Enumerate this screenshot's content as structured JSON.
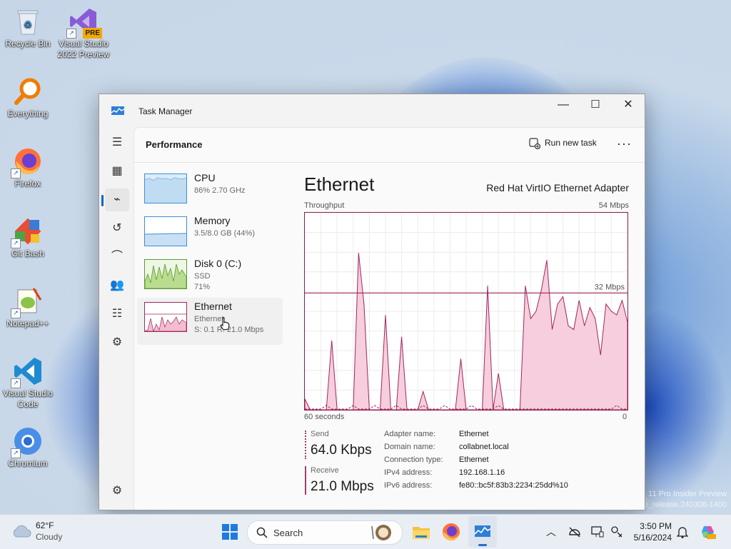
{
  "desktop": {
    "icons": [
      {
        "label": "Recycle Bin",
        "icon": "recycle-bin-icon"
      },
      {
        "label": "Visual Studio 2022 Preview",
        "icon": "visual-studio-icon",
        "badge": "PRE"
      },
      {
        "label": "Everything",
        "icon": "everything-search-icon"
      },
      {
        "label": "Firefox",
        "icon": "firefox-icon"
      },
      {
        "label": "Git Bash",
        "icon": "git-bash-icon"
      },
      {
        "label": "Notepad++",
        "icon": "notepad-plus-plus-icon"
      },
      {
        "label": "Visual Studio Code",
        "icon": "vscode-icon"
      },
      {
        "label": "Chromium",
        "icon": "chromium-icon"
      }
    ],
    "watermark_line1": "11 Pro Insider Preview",
    "watermark_line2": "e_release.240308-1400"
  },
  "window": {
    "title": "Task Manager",
    "controls": {
      "minimize": "—",
      "maximize": "☐",
      "close": "✕"
    }
  },
  "rail": {
    "items": [
      {
        "name": "menu-icon",
        "glyph": "☰"
      },
      {
        "name": "processes-icon",
        "glyph": "▦"
      },
      {
        "name": "performance-icon",
        "glyph": "⌁",
        "active": true
      },
      {
        "name": "app-history-icon",
        "glyph": "↺"
      },
      {
        "name": "startup-apps-icon",
        "glyph": "⌒"
      },
      {
        "name": "users-icon",
        "glyph": "👥"
      },
      {
        "name": "details-icon",
        "glyph": "☷"
      },
      {
        "name": "services-icon",
        "glyph": "⚙"
      }
    ],
    "settings_glyph": "⚙"
  },
  "header": {
    "title": "Performance",
    "run_new_task": "Run new task",
    "more": "···"
  },
  "resources": [
    {
      "name": "CPU",
      "line1": "86% 2.70 GHz",
      "line2": ""
    },
    {
      "name": "Memory",
      "line1": "3.5/8.0 GB (44%)",
      "line2": ""
    },
    {
      "name": "Disk 0 (C:)",
      "line1": "SSD",
      "line2": "71%"
    },
    {
      "name": "Ethernet",
      "line1": "Ethernet",
      "line2": "S: 0.1 R: 21.0 Mbps"
    }
  ],
  "detail": {
    "title": "Ethernet",
    "adapter": "Red Hat VirtIO Ethernet Adapter",
    "throughput_label": "Throughput",
    "max_label": "54 Mbps",
    "ref_label": "32 Mbps",
    "x_left": "60 seconds",
    "x_right": "0",
    "send_label": "Send",
    "send_value": "64.0 Kbps",
    "receive_label": "Receive",
    "receive_value": "21.0 Mbps",
    "info": [
      {
        "key": "Adapter name:",
        "value": "Ethernet"
      },
      {
        "key": "Domain name:",
        "value": "collabnet.local"
      },
      {
        "key": "Connection type:",
        "value": "Ethernet"
      },
      {
        "key": "IPv4 address:",
        "value": "192.168.1.16"
      },
      {
        "key": "IPv6 address:",
        "value": "fe80::bc5f:83b3:2234:25dd%10"
      }
    ]
  },
  "chart_data": {
    "type": "area",
    "ylim": [
      0,
      54
    ],
    "x": [
      60,
      59,
      58,
      57,
      56,
      55,
      54,
      53,
      52,
      51,
      50,
      49,
      48,
      47,
      46,
      45,
      44,
      43,
      42,
      41,
      40,
      39,
      38,
      37,
      36,
      35,
      34,
      33,
      32,
      31,
      30,
      29,
      28,
      27,
      26,
      25,
      24,
      23,
      22,
      21,
      20,
      19,
      18,
      17,
      16,
      15,
      14,
      13,
      12,
      11,
      10,
      9,
      8,
      7,
      6,
      5,
      4,
      3,
      2,
      1,
      0
    ],
    "series": [
      {
        "values": [
          3,
          0,
          0,
          0,
          0,
          19,
          0,
          0,
          0,
          0,
          43,
          29,
          0,
          0,
          0,
          26,
          0,
          0,
          20,
          0,
          0,
          0,
          5,
          0,
          0,
          0,
          0,
          0,
          0,
          14,
          0,
          0,
          0,
          0,
          34,
          0,
          10,
          0,
          0,
          0,
          0,
          34,
          25,
          27,
          33,
          41,
          22,
          29,
          31,
          23,
          22,
          30,
          23,
          28,
          25,
          15,
          29,
          27,
          26,
          30,
          24
        ]
      },
      {
        "values": [
          0,
          0,
          0,
          0,
          1,
          0,
          0,
          0,
          0,
          1,
          0,
          0,
          0,
          1,
          0,
          0,
          0,
          1,
          0,
          0,
          0,
          0,
          1,
          0,
          0,
          0,
          1,
          0,
          0,
          0,
          0,
          1,
          0,
          0,
          0,
          0,
          1,
          0,
          0,
          0,
          0,
          0,
          0,
          0,
          0,
          0,
          0,
          0,
          0,
          0,
          0,
          0,
          0,
          0,
          0,
          0,
          0,
          0,
          1,
          0,
          0
        ]
      }
    ],
    "reference_line": 32,
    "colors": {
      "line": "#a3265c",
      "fill": "#f6cedd",
      "grid": "#ececec"
    }
  },
  "taskbar": {
    "weather_temp": "62°F",
    "weather_desc": "Cloudy",
    "search_placeholder": "Search",
    "time": "3:50 PM",
    "date": "5/16/2024"
  }
}
